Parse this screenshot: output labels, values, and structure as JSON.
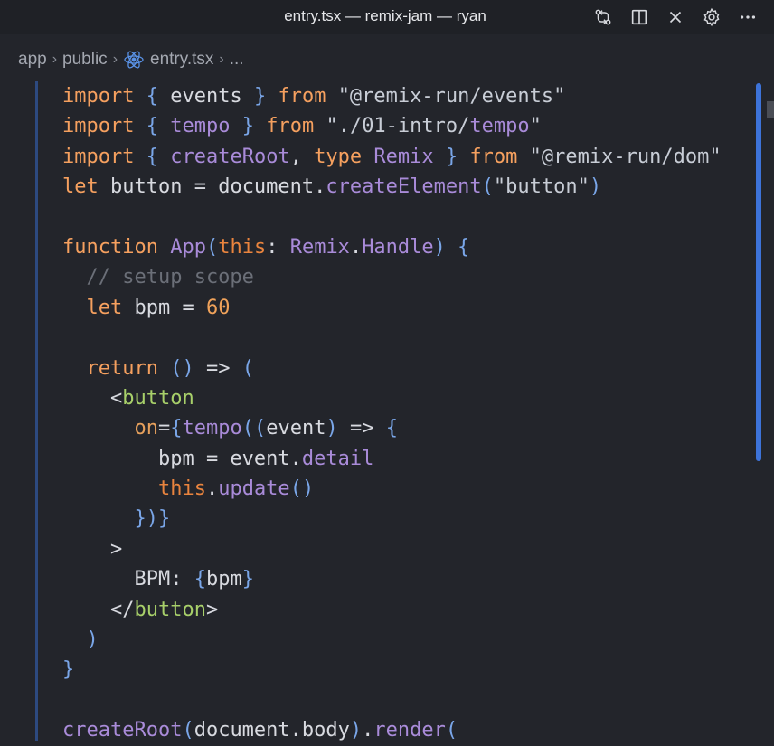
{
  "window": {
    "title": "entry.tsx — remix-jam — ryan",
    "icons": [
      "source-control-icon",
      "split-editor-icon",
      "close-icon",
      "gear-icon",
      "more-icon"
    ]
  },
  "breadcrumb": {
    "items": [
      "app",
      "public",
      "entry.tsx",
      "..."
    ],
    "file_icon": "react-icon"
  },
  "editor": {
    "lines": [
      "import { events } from \"@remix-run/events\"",
      "import { tempo } from \"./01-intro/tempo\"",
      "import { createRoot, type Remix } from \"@remix-run/dom\"",
      "let button = document.createElement(\"button\")",
      "",
      "function App(this: Remix.Handle) {",
      "  // setup scope",
      "  let bpm = 60",
      "",
      "  return () => (",
      "    <button",
      "      on={tempo((event) => {",
      "        bpm = event.detail",
      "        this.update()",
      "      })}",
      "    >",
      "      BPM: {bpm}",
      "    </button>",
      "  )",
      "}",
      "",
      "createRoot(document.body).render("
    ]
  },
  "colors": {
    "background": "#23252b",
    "keyword": "#f5a05f",
    "function": "#a98bd9",
    "tag": "#a8d06a",
    "comment": "#6b6f78",
    "scrollbar": "#3d73d9"
  }
}
